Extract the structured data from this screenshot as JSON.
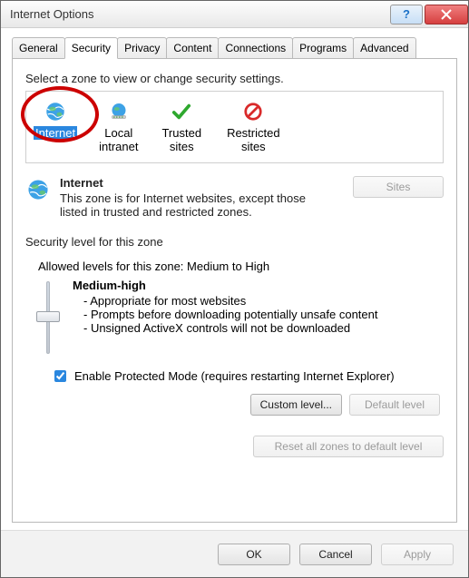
{
  "window": {
    "title": "Internet Options"
  },
  "tabs": [
    {
      "label": "General"
    },
    {
      "label": "Security"
    },
    {
      "label": "Privacy"
    },
    {
      "label": "Content"
    },
    {
      "label": "Connections"
    },
    {
      "label": "Programs"
    },
    {
      "label": "Advanced"
    }
  ],
  "zone": {
    "prompt": "Select a zone to view or change security settings.",
    "items": [
      {
        "label": "Internet",
        "sub": ""
      },
      {
        "label": "Local",
        "sub": "intranet"
      },
      {
        "label": "Trusted",
        "sub": "sites"
      },
      {
        "label": "Restricted",
        "sub": "sites"
      }
    ]
  },
  "selected": {
    "title": "Internet",
    "desc": "This zone is for Internet websites, except those listed in trusted and restricted zones.",
    "sites_btn": "Sites"
  },
  "level": {
    "group_label": "Security level for this zone",
    "allowed": "Allowed levels for this zone: Medium to High",
    "name": "Medium-high",
    "b1": "- Appropriate for most websites",
    "b2": "- Prompts before downloading potentially unsafe content",
    "b3": "- Unsigned ActiveX controls will not be downloaded",
    "protected": "Enable Protected Mode (requires restarting Internet Explorer)",
    "custom_btn": "Custom level...",
    "default_btn": "Default level",
    "reset_btn": "Reset all zones to default level"
  },
  "footer": {
    "ok": "OK",
    "cancel": "Cancel",
    "apply": "Apply"
  }
}
